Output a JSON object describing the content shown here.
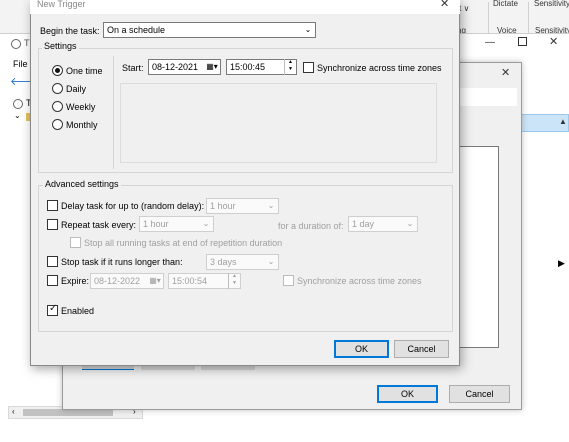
{
  "ribbon": {
    "item1": "ct ∨",
    "item2": "Dictate",
    "item3": "Sensitivity",
    "group1": "ng",
    "group2": "Voice",
    "group3": "Sensitivity"
  },
  "background": {
    "menu_file": "File",
    "ok_label": "OK",
    "cancel_label": "Cancel"
  },
  "dialog": {
    "title": "New Trigger",
    "begin_task_label": "Begin the task:",
    "begin_task_value": "On a schedule",
    "settings_legend": "Settings",
    "radios": [
      "One time",
      "Daily",
      "Weekly",
      "Monthly"
    ],
    "selected_radio": "One time",
    "start_label": "Start:",
    "start_date": "08-12-2021",
    "start_time": "15:00:45",
    "sync_label": "Synchronize across time zones",
    "advanced_legend": "Advanced settings",
    "delay_label": "Delay task for up to (random delay):",
    "delay_value": "1 hour",
    "repeat_label": "Repeat task every:",
    "repeat_value": "1 hour",
    "duration_label": "for a duration of:",
    "duration_value": "1 day",
    "stop_all_label": "Stop all running tasks at end of repetition duration",
    "stop_longer_label": "Stop task if it runs longer than:",
    "stop_longer_value": "3 days",
    "expire_label": "Expire:",
    "expire_date": "08-12-2022",
    "expire_time": "15:00:54",
    "expire_sync_label": "Synchronize across time zones",
    "enabled_label": "Enabled",
    "ok_label": "OK",
    "cancel_label": "Cancel",
    "close_glyph": "✕"
  }
}
